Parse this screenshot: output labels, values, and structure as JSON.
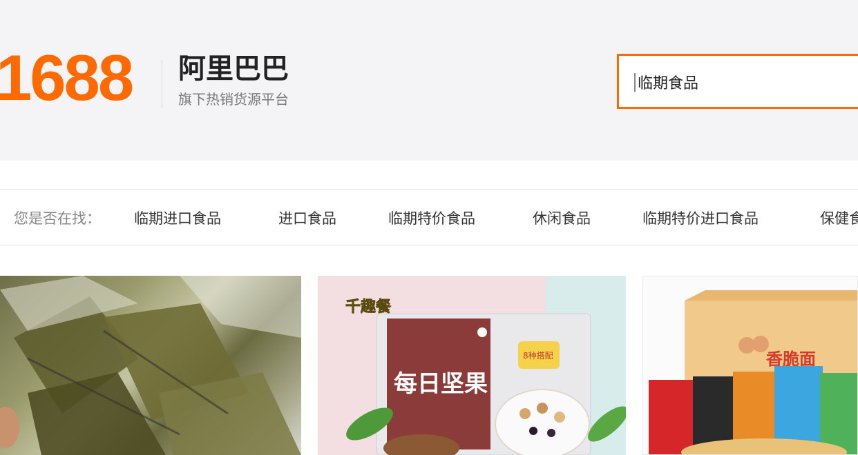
{
  "header": {
    "logo_number": "1688",
    "logo_name": "阿里巴巴",
    "logo_tagline": "旗下热销货源平台",
    "brand_color": "#ff6a00"
  },
  "search": {
    "value": "临期食品"
  },
  "suggestions": {
    "label": "您是否在找：",
    "items": [
      "临期进口食品",
      "进口食品",
      "临期特价食品",
      "休闲食品",
      "临期特价进口食品",
      "保健食"
    ]
  },
  "products": [
    {
      "image": "zongzi-product-photo"
    },
    {
      "image": "mixed-nuts-product-photo",
      "brand_text": "千趣餐",
      "package_title": "每日坚果",
      "badge": "8种搭配"
    },
    {
      "image": "instant-noodle-box-photo",
      "box_title": "香脆面"
    }
  ]
}
